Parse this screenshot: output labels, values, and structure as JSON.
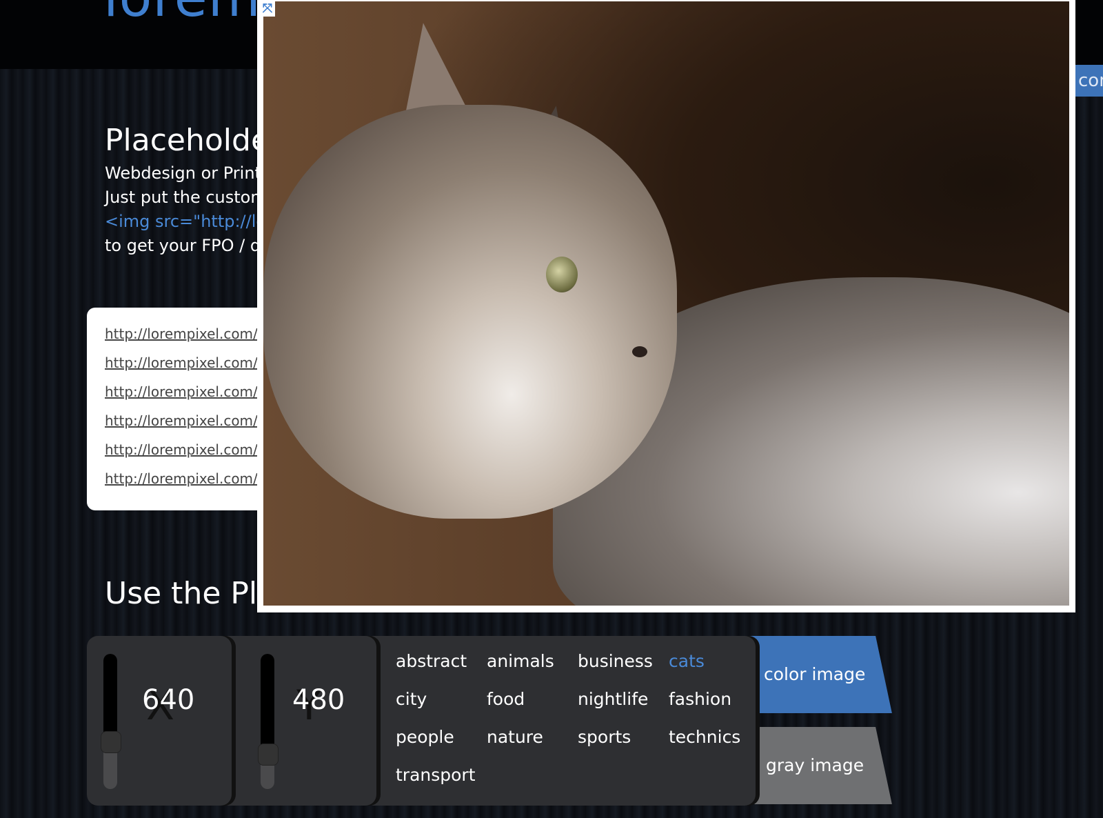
{
  "header": {
    "logo_partial": "lorem"
  },
  "intro": {
    "title": "Placeholder",
    "lines": [
      "Webdesign or Print",
      "Just put the custom",
      "<img src=\"http://lo",
      "to get your FPO / du"
    ]
  },
  "links": [
    "http://lorempixel.com/",
    "http://lorempixel.com/",
    "http://lorempixel.com/",
    "http://lorempixel.com/",
    "http://lorempixel.com/",
    "http://lorempixel.com/"
  ],
  "use_heading": "Use the Pla",
  "side_tab": "com",
  "modal": {
    "close_icon": "fullscreen-close-icon",
    "image": "cat photo"
  },
  "controls": {
    "width": {
      "label": "X",
      "value": "640",
      "slider_level": 0.3
    },
    "height": {
      "label": "Y",
      "value": "480",
      "slider_level": 0.22
    },
    "categories": [
      "abstract",
      "animals",
      "business",
      "cats",
      "city",
      "food",
      "nightlife",
      "fashion",
      "people",
      "nature",
      "sports",
      "technics",
      "transport"
    ],
    "selected_category": "cats",
    "color_image": "color image",
    "gray_image": "gray image",
    "accent": "#3d73b8"
  }
}
